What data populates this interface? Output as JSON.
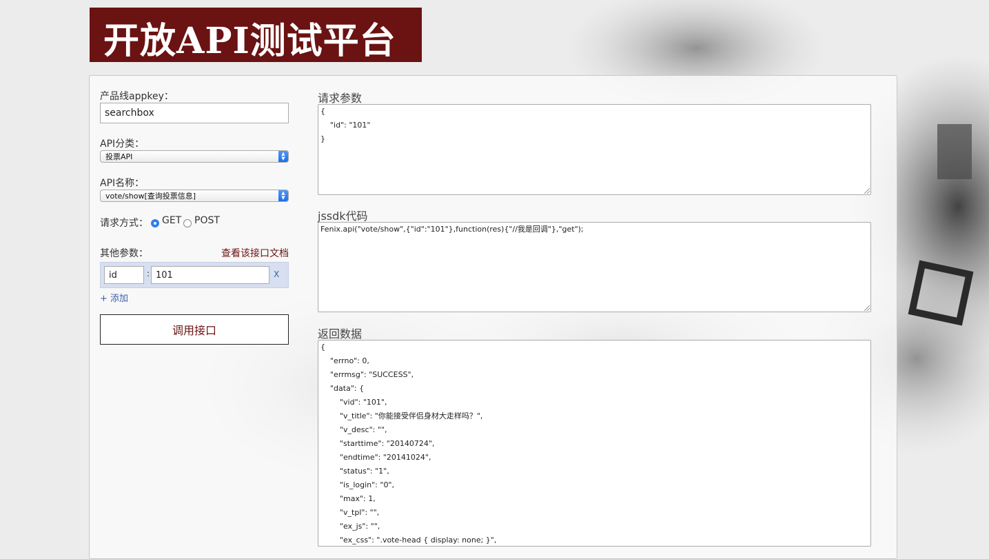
{
  "banner": {
    "title": "开放API测试平台"
  },
  "form": {
    "appkey_label": "产品线appkey：",
    "appkey_value": "searchbox",
    "category_label": "API分类：",
    "category_selected": "投票API",
    "name_label": "API名称：",
    "name_selected": "vote/show[查询投票信息]",
    "method_label": "请求方式：",
    "method_options": [
      {
        "label": "GET",
        "checked": true
      },
      {
        "label": "POST",
        "checked": false
      }
    ],
    "other_params_label": "其他参数：",
    "doc_link": "查看该接口文档",
    "param": {
      "key": "id",
      "separator": ":",
      "value": "101",
      "remove": "X"
    },
    "add_link": "+ 添加",
    "call_button": "调用接口"
  },
  "request_params": {
    "title": "请求参数",
    "lines": [
      "{",
      "    \"id\": \"101\"",
      "}"
    ]
  },
  "jssdk": {
    "title": "jssdk代码",
    "code": "Fenix.api(\"vote/show\",{\"id\":\"101\"},function(res){\"//我是回调\"},\"get\");"
  },
  "response": {
    "title": "返回数据",
    "lines": [
      "{",
      "    \"errno\": 0,",
      "    \"errmsg\": \"SUCCESS\",",
      "    \"data\": {",
      "        \"vid\": \"101\",",
      "        \"v_title\": \"你能接受伴侣身材大走样吗？\",",
      "        \"v_desc\": \"\",",
      "        \"starttime\": \"20140724\",",
      "        \"endtime\": \"20141024\",",
      "        \"status\": \"1\",",
      "        \"is_login\": \"0\",",
      "        \"max\": 1,",
      "        \"v_tpl\": \"\",",
      "        \"ex_js\": \"\",",
      "        \"ex_css\": \".vote-head { display: none; }\","
    ]
  },
  "colors": {
    "brand": "#6b1212",
    "radio_accent": "#2f7ef1",
    "param_row_bg": "#d7dff0"
  }
}
